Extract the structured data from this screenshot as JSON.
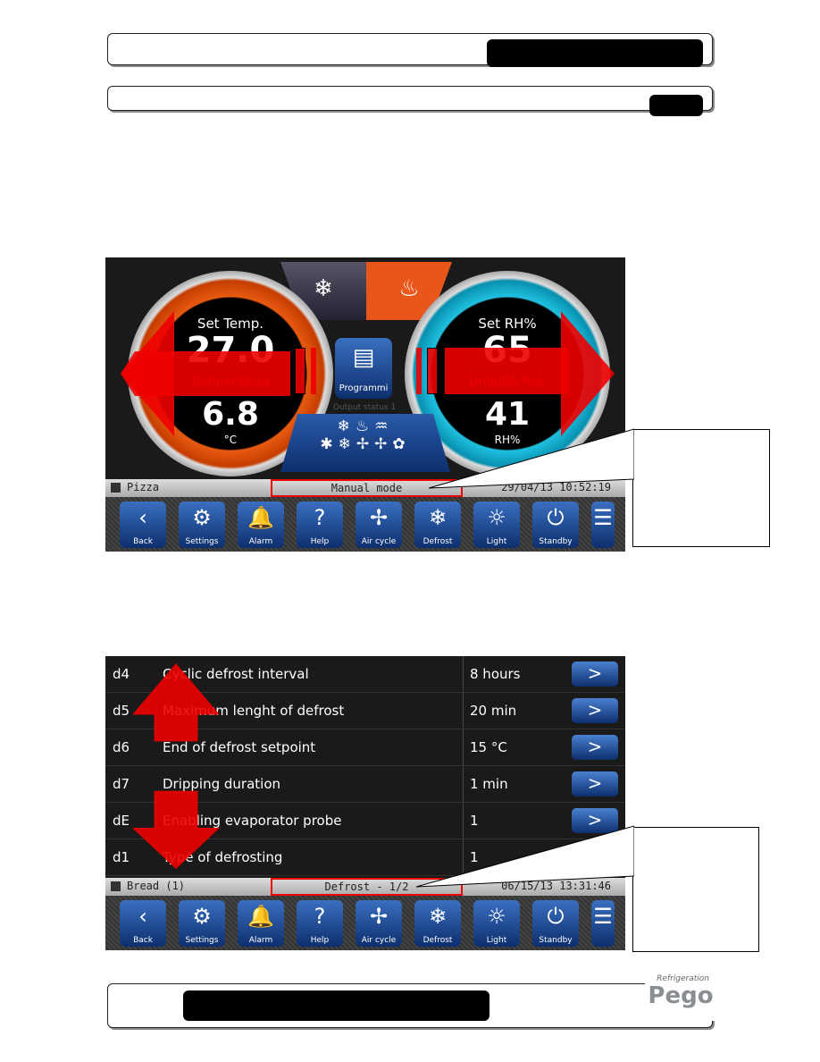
{
  "screen1": {
    "mode_icons": [
      "snowflake-hand-icon",
      "flame-hand-icon"
    ],
    "temp": {
      "label": "Set Temp.",
      "setpoint": "27.0",
      "name": "Temperatura",
      "value": "6.8",
      "unit": "°C"
    },
    "humidity": {
      "label": "Set RH%",
      "setpoint": "65",
      "name": "Umidità Rel.",
      "value": "41",
      "unit": "RH%"
    },
    "programs_label": "Programmi",
    "output_status": "Output status 1",
    "status_bar": {
      "program": "Pizza",
      "mode": "Manual mode",
      "datetime": "29/04/13 10:52:19"
    }
  },
  "screen2": {
    "rows": [
      {
        "code": "d4",
        "desc": "Cyclic defrost interval",
        "value": "8  hours"
      },
      {
        "code": "d5",
        "desc": "Maximum lenght of defrost",
        "value": "20  min"
      },
      {
        "code": "d6",
        "desc": "End of defrost setpoint",
        "value": "15  °C"
      },
      {
        "code": "d7",
        "desc": "Dripping duration",
        "value": "1  min"
      },
      {
        "code": "dE",
        "desc": "Enabling  evaporator probe",
        "value": "1"
      },
      {
        "code": "d1",
        "desc": "Type of defrosting",
        "value": "1"
      }
    ],
    "status_bar": {
      "program": "Bread (1)",
      "mode": "Defrost - 1/2",
      "datetime": "06/15/13  13:31:46"
    }
  },
  "toolbar": [
    {
      "label": "Back",
      "icon": "‹"
    },
    {
      "label": "Settings",
      "icon": "⚙"
    },
    {
      "label": "Alarm",
      "icon": "🔔"
    },
    {
      "label": "Help",
      "icon": "?"
    },
    {
      "label": "Air cycle",
      "icon": "✢"
    },
    {
      "label": "Defrost",
      "icon": "❄"
    },
    {
      "label": "Light",
      "icon": "☼"
    },
    {
      "label": "Standby",
      "icon": "⏻"
    }
  ],
  "logo": {
    "brand": "Pego",
    "tagline": "Refrigeration"
  },
  "colors": {
    "highlight": "#e00000",
    "button": "#1a4a9a"
  }
}
